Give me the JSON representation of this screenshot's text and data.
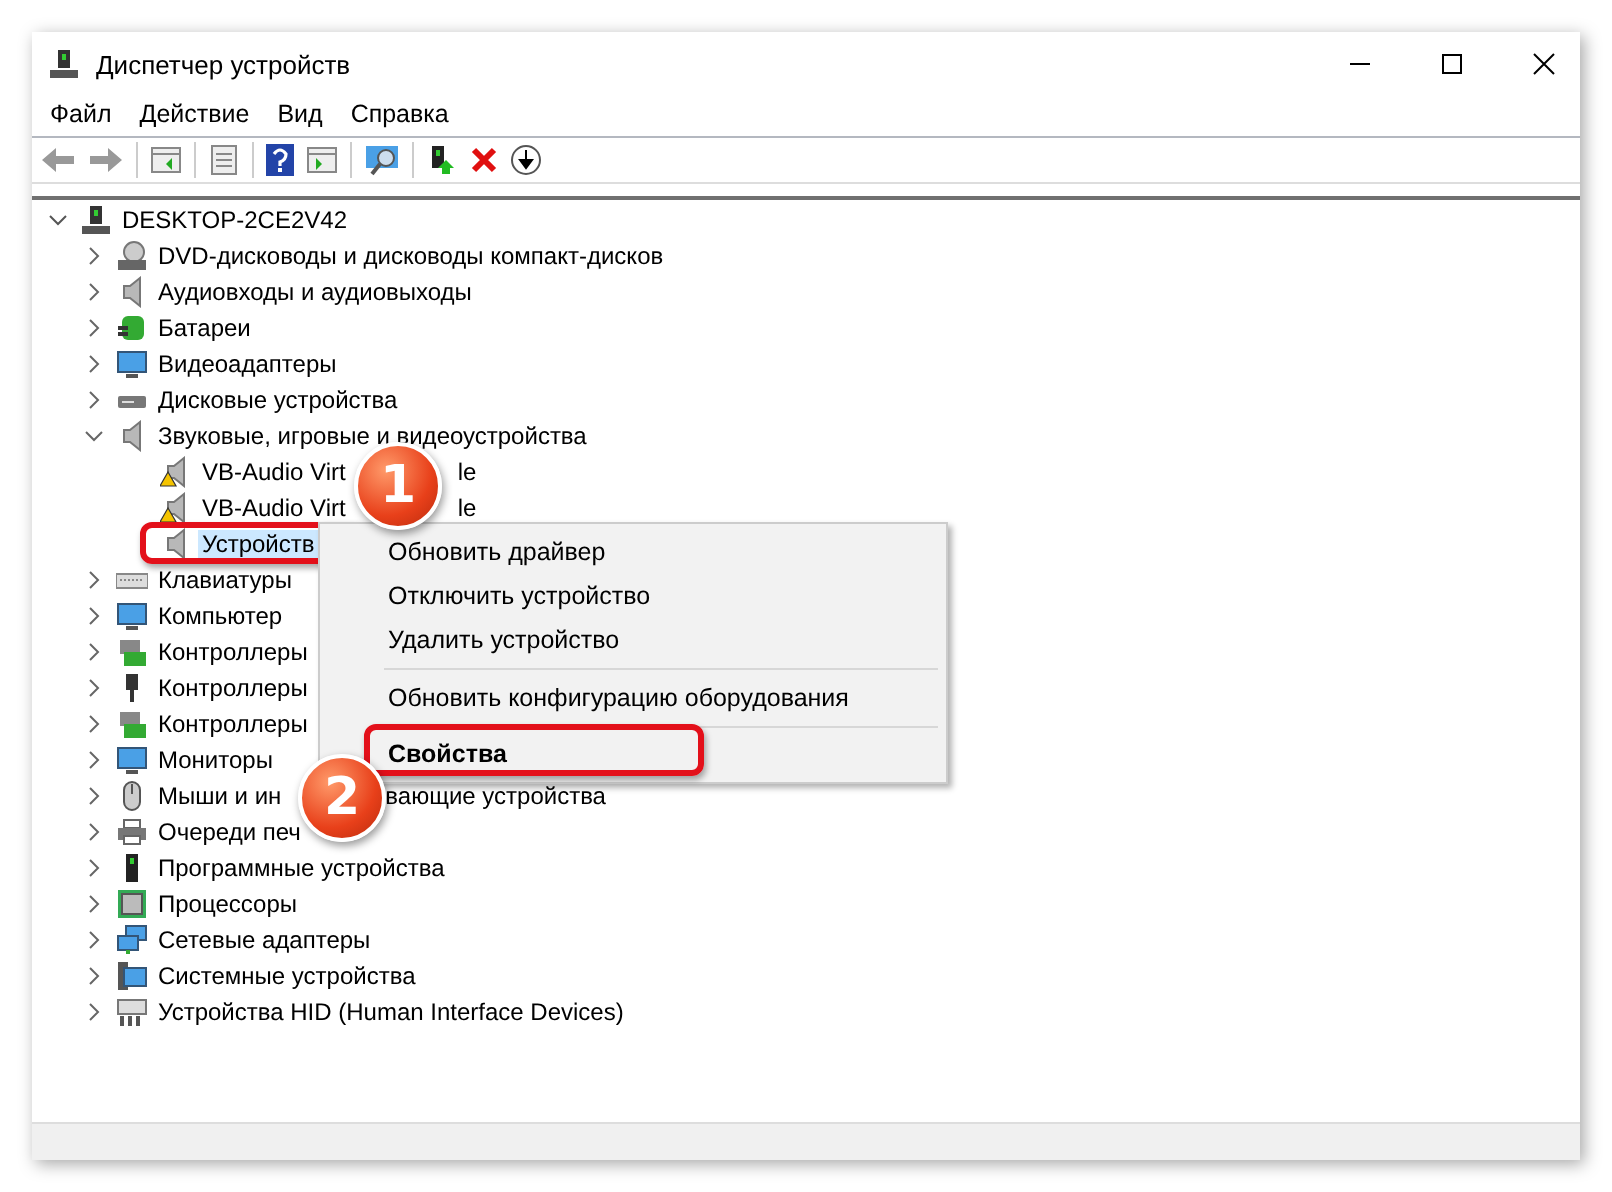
{
  "window": {
    "title": "Диспетчер устройств"
  },
  "menu": [
    "Файл",
    "Действие",
    "Вид",
    "Справка"
  ],
  "tree": {
    "label": "DESKTOP-2CE2V42",
    "expanded": true,
    "selected": false,
    "children": [
      {
        "label": "DVD-дисководы и дисководы компакт-дисков",
        "expanded": false,
        "selected": false
      },
      {
        "label": "Аудиовходы и аудиовыходы",
        "expanded": false,
        "selected": false
      },
      {
        "label": "Батареи",
        "expanded": false,
        "selected": false
      },
      {
        "label": "Видеоадаптеры",
        "expanded": false,
        "selected": false
      },
      {
        "label": "Дисковые устройства",
        "expanded": false,
        "selected": false
      },
      {
        "label": "Звуковые, игровые и видеоустройства",
        "expanded": true,
        "selected": false,
        "children": [
          {
            "label": "VB-Audio Virt",
            "tail": "le",
            "warning": true,
            "selected": false
          },
          {
            "label": "VB-Audio Virt",
            "tail": "le",
            "warning": true,
            "selected": false
          },
          {
            "label": "Устройств",
            "warning": false,
            "selected": true
          }
        ]
      },
      {
        "label": "Клавиатуры",
        "expanded": false,
        "selected": false
      },
      {
        "label": "Компьютер",
        "expanded": false,
        "selected": false
      },
      {
        "label": "Контроллеры",
        "expanded": false,
        "selected": false
      },
      {
        "label": "Контроллеры",
        "expanded": false,
        "selected": false
      },
      {
        "label": "Контроллеры",
        "expanded": false,
        "selected": false
      },
      {
        "label": "Мониторы",
        "expanded": false,
        "selected": false
      },
      {
        "label": "Мыши и ин",
        "tail": "вающие устройства",
        "expanded": false,
        "selected": false
      },
      {
        "label": "Очереди печ",
        "expanded": false,
        "selected": false
      },
      {
        "label": "Программные устройства",
        "expanded": false,
        "selected": false
      },
      {
        "label": "Процессоры",
        "expanded": false,
        "selected": false
      },
      {
        "label": "Сетевые адаптеры",
        "expanded": false,
        "selected": false
      },
      {
        "label": "Системные устройства",
        "expanded": false,
        "selected": false
      },
      {
        "label": "Устройства HID (Human Interface Devices)",
        "expanded": false,
        "selected": false
      }
    ]
  },
  "context_menu": [
    {
      "kind": "item",
      "label": "Обновить драйвер"
    },
    {
      "kind": "item",
      "label": "Отключить устройство"
    },
    {
      "kind": "item",
      "label": "Удалить устройство"
    },
    {
      "kind": "separator"
    },
    {
      "kind": "item",
      "label": "Обновить конфигурацию оборудования"
    },
    {
      "kind": "separator"
    },
    {
      "kind": "default",
      "label": "Свойства"
    }
  ],
  "callouts": [
    "1",
    "2"
  ]
}
